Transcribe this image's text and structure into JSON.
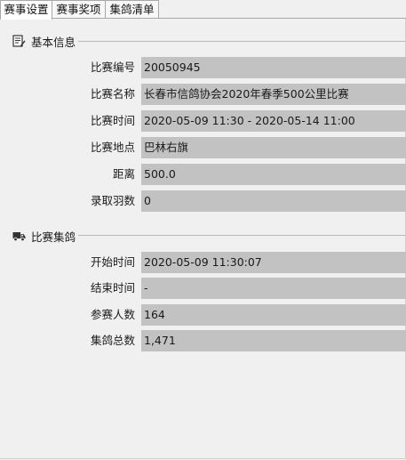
{
  "tabs": [
    {
      "label": "赛事设置"
    },
    {
      "label": "赛事奖项"
    },
    {
      "label": "集鸽清单"
    }
  ],
  "basic": {
    "title": "基本信息",
    "icon": "edit-document-icon",
    "fields": [
      {
        "label": "比赛编号",
        "value": "20050945"
      },
      {
        "label": "比赛名称",
        "value": "长春市信鸽协会2020年春季500公里比赛"
      },
      {
        "label": "比赛时间",
        "value": "2020-05-09 11:30 - 2020-05-14 11:00"
      },
      {
        "label": "比赛地点",
        "value": "巴林右旗"
      },
      {
        "label": "距离",
        "value": "500.0"
      },
      {
        "label": "录取羽数",
        "value": "0"
      }
    ]
  },
  "collect": {
    "title": "比赛集鸽",
    "icon": "truck-icon",
    "fields": [
      {
        "label": "开始时间",
        "value": "2020-05-09 11:30:07"
      },
      {
        "label": "结束时间",
        "value": "-"
      },
      {
        "label": "参赛人数",
        "value": "164"
      },
      {
        "label": "集鸽总数",
        "value": "1,471"
      }
    ]
  }
}
